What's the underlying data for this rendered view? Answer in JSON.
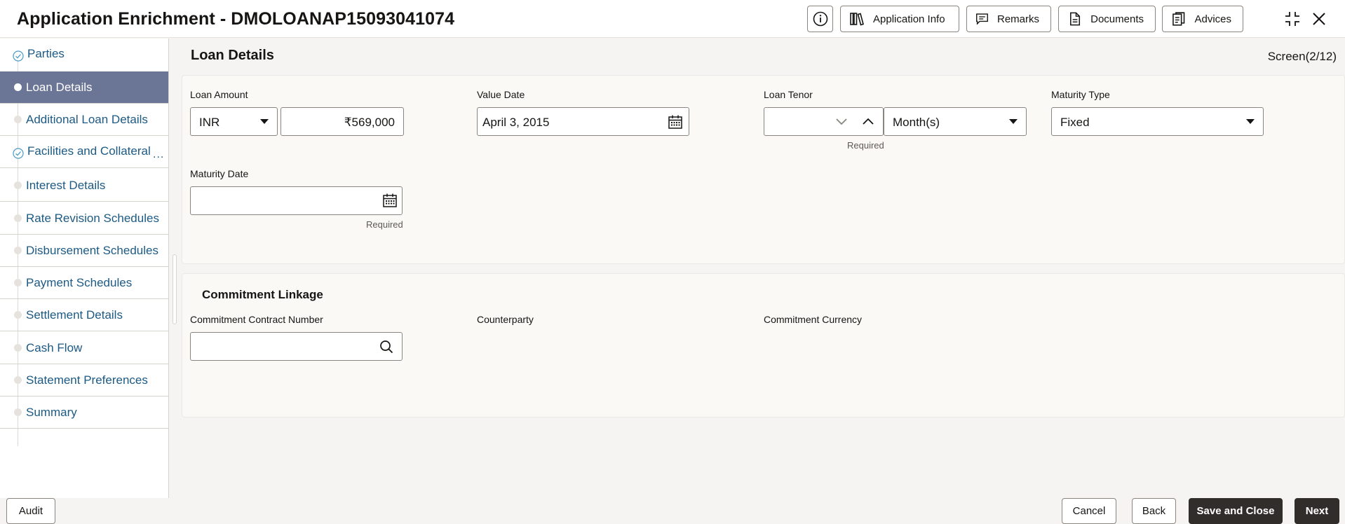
{
  "header": {
    "title": "Application Enrichment - DMOLOANAP15093041074",
    "buttons": {
      "info_icon": "info-icon",
      "application_info": "Application Info",
      "remarks": "Remarks",
      "documents": "Documents",
      "advices": "Advices"
    }
  },
  "sidebar": {
    "items": [
      {
        "label": "Parties",
        "state": "completed"
      },
      {
        "label": "Loan Details",
        "state": "active"
      },
      {
        "label": "Additional Loan Details",
        "state": "pending"
      },
      {
        "label": "Facilities and Collateral",
        "state": "completed",
        "more": "..."
      },
      {
        "label": "Interest Details",
        "state": "pending"
      },
      {
        "label": "Rate Revision Schedules",
        "state": "pending"
      },
      {
        "label": "Disbursement Schedules",
        "state": "pending"
      },
      {
        "label": "Payment Schedules",
        "state": "pending"
      },
      {
        "label": "Settlement Details",
        "state": "pending"
      },
      {
        "label": "Cash Flow",
        "state": "pending"
      },
      {
        "label": "Statement Preferences",
        "state": "pending"
      },
      {
        "label": "Summary",
        "state": "pending"
      }
    ]
  },
  "main": {
    "title": "Loan Details",
    "screen_counter": "Screen(2/12)",
    "loan_details": {
      "loan_amount_label": "Loan Amount",
      "currency": "INR",
      "amount": "₹569,000",
      "value_date_label": "Value Date",
      "value_date": "April 3, 2015",
      "loan_tenor_label": "Loan Tenor",
      "tenor_value": "",
      "tenor_required": "Required",
      "tenor_unit": "Month(s)",
      "maturity_type_label": "Maturity Type",
      "maturity_type": "Fixed",
      "maturity_date_label": "Maturity Date",
      "maturity_date": "",
      "maturity_date_required": "Required"
    },
    "commitment": {
      "title": "Commitment Linkage",
      "contract_number_label": "Commitment Contract Number",
      "contract_number": "",
      "counterparty_label": "Counterparty",
      "currency_label": "Commitment Currency"
    }
  },
  "footer": {
    "audit": "Audit",
    "cancel": "Cancel",
    "back": "Back",
    "save_and_close": "Save and Close",
    "next": "Next"
  },
  "colors": {
    "active_nav": "#6b7697",
    "link": "#1c5a84",
    "primary_button": "#312d2a"
  }
}
